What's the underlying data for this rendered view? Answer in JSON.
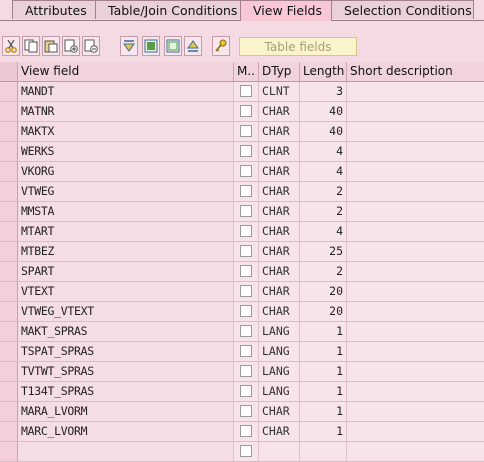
{
  "tabs": [
    {
      "label": "Attributes",
      "active": false
    },
    {
      "label": "Table/Join Conditions",
      "active": false
    },
    {
      "label": "View Fields",
      "active": true
    },
    {
      "label": "Selection Conditions",
      "active": false
    }
  ],
  "toolbar": {
    "icons": [
      "cut-icon",
      "copy-icon",
      "paste-icon",
      "insert-row-icon",
      "delete-row-icon",
      "sort-descending-icon",
      "select-all-icon",
      "deselect-all-icon",
      "sort-ascending-icon",
      "key-icon"
    ],
    "table_fields_label": "Table fields"
  },
  "grid": {
    "columns": [
      "View field",
      "M..",
      "DTyp",
      "Length",
      "Short description"
    ],
    "rows": [
      {
        "field": "MANDT",
        "dtyp": "CLNT",
        "length": "3",
        "desc": ""
      },
      {
        "field": "MATNR",
        "dtyp": "CHAR",
        "length": "40",
        "desc": ""
      },
      {
        "field": "MAKTX",
        "dtyp": "CHAR",
        "length": "40",
        "desc": ""
      },
      {
        "field": "WERKS",
        "dtyp": "CHAR",
        "length": "4",
        "desc": ""
      },
      {
        "field": "VKORG",
        "dtyp": "CHAR",
        "length": "4",
        "desc": ""
      },
      {
        "field": "VTWEG",
        "dtyp": "CHAR",
        "length": "2",
        "desc": ""
      },
      {
        "field": "MMSTA",
        "dtyp": "CHAR",
        "length": "2",
        "desc": ""
      },
      {
        "field": "MTART",
        "dtyp": "CHAR",
        "length": "4",
        "desc": ""
      },
      {
        "field": "MTBEZ",
        "dtyp": "CHAR",
        "length": "25",
        "desc": ""
      },
      {
        "field": "SPART",
        "dtyp": "CHAR",
        "length": "2",
        "desc": ""
      },
      {
        "field": "VTEXT",
        "dtyp": "CHAR",
        "length": "20",
        "desc": ""
      },
      {
        "field": "VTWEG_VTEXT",
        "dtyp": "CHAR",
        "length": "20",
        "desc": ""
      },
      {
        "field": "MAKT_SPRAS",
        "dtyp": "LANG",
        "length": "1",
        "desc": ""
      },
      {
        "field": "TSPAT_SPRAS",
        "dtyp": "LANG",
        "length": "1",
        "desc": ""
      },
      {
        "field": "TVTWT_SPRAS",
        "dtyp": "LANG",
        "length": "1",
        "desc": ""
      },
      {
        "field": "T134T_SPRAS",
        "dtyp": "LANG",
        "length": "1",
        "desc": ""
      },
      {
        "field": "MARA_LVORM",
        "dtyp": "CHAR",
        "length": "1",
        "desc": ""
      },
      {
        "field": "MARC_LVORM",
        "dtyp": "CHAR",
        "length": "1",
        "desc": ""
      },
      {
        "field": "",
        "dtyp": "",
        "length": "",
        "desc": ""
      }
    ]
  }
}
